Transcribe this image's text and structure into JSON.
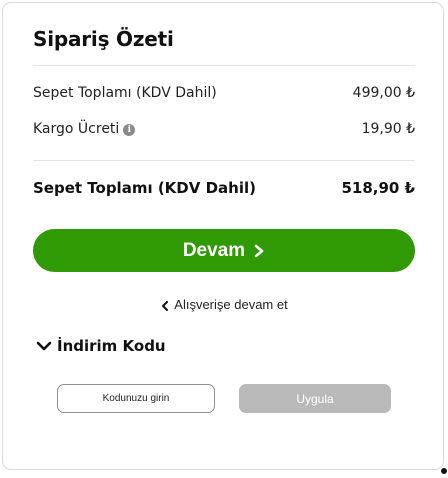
{
  "summary": {
    "title": "Sipariş Özeti",
    "rows": [
      {
        "label": "Sepet Toplamı (KDV Dahil)",
        "value": "499,00 ₺"
      },
      {
        "label": "Kargo Ücreti",
        "value": "19,90 ₺",
        "icon": "info-icon"
      }
    ],
    "total": {
      "label": "Sepet Toplamı (KDV Dahil)",
      "value": "518,90 ₺"
    }
  },
  "actions": {
    "continue_label": "Devam",
    "back_label": "Alışverişe devam et"
  },
  "discount": {
    "toggle_label": "İndirim Kodu",
    "input_placeholder": "Kodunuzu girin",
    "apply_label": "Uygula"
  },
  "colors": {
    "primary": "#2f9a04",
    "disabled": "#b9b9b9",
    "border": "#d9d9d9"
  }
}
